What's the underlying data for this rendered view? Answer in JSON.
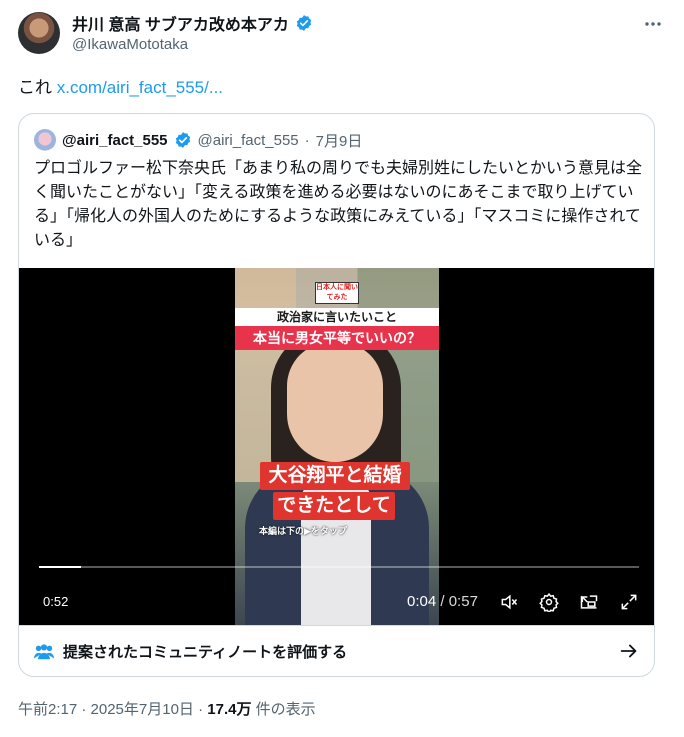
{
  "author": {
    "display_name": "井川 意高 サブアカ改め本アカ",
    "handle": "@IkawaMototaka",
    "more_icon": "more-dots-icon"
  },
  "tweet": {
    "text": "これ ",
    "link": "x.com/airi_fact_555/..."
  },
  "quote": {
    "display_name": "@airi_fact_555",
    "handle": "@airi_fact_555",
    "separator": "·",
    "date": "7月9日",
    "text": "プロゴルファー松下奈央氏「あまり私の周りでも夫婦別姓にしたいとかいう意見は全く聞いたことがない」「変える政策を進める必要はないのにあそこまで取り上げている」「帰化人の外国人のためにするような政策にみえている」「マスコミに操作されている」"
  },
  "video": {
    "overlay_small": "日本人に聞いてみた",
    "overlay_title1": "政治家に言いたいこと",
    "overlay_title2": "本当に男女平等でいいの？",
    "caption_line1": "大谷翔平と結婚",
    "caption_line2": "できたとして",
    "tap_hint": "本編は下の▶をタップ",
    "duration_badge": "0:52",
    "current_time": "0:04",
    "time_separator": " / ",
    "total_time": "0:57",
    "progress": 0.07,
    "controls": [
      "mute-icon",
      "settings-icon",
      "pip-icon",
      "fullscreen-icon"
    ]
  },
  "community_note": {
    "label": "提案されたコミュニティノートを評価する"
  },
  "footer": {
    "timestamp": "午前2:17 · 2025年7月10日 · ",
    "views": "17.4万",
    "views_suffix": " 件の表示"
  },
  "colors": {
    "accent": "#1d9bf0",
    "verified": "#1d9bf0",
    "secondary_text": "#536471",
    "border": "#cfd9de"
  }
}
